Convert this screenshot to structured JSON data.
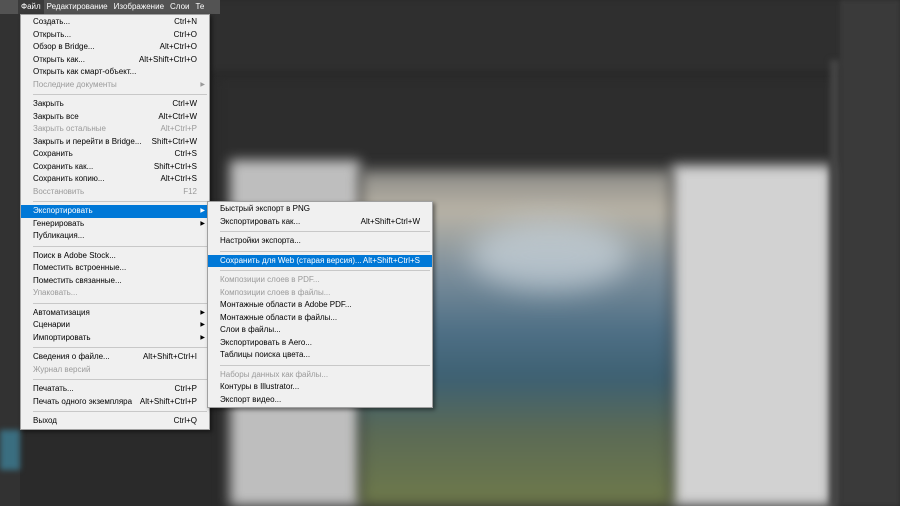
{
  "menubar": {
    "items": [
      "Файл",
      "Редактирование",
      "Изображение",
      "Слои",
      "Те"
    ]
  },
  "file_menu": {
    "items": [
      {
        "label": "Создать...",
        "shortcut": "Ctrl+N"
      },
      {
        "label": "Открыть...",
        "shortcut": "Ctrl+O"
      },
      {
        "label": "Обзор в Bridge...",
        "shortcut": "Alt+Ctrl+O"
      },
      {
        "label": "Открыть как...",
        "shortcut": "Alt+Shift+Ctrl+O"
      },
      {
        "label": "Открыть как смарт-объект...",
        "shortcut": ""
      },
      {
        "label": "Последние документы",
        "shortcut": "",
        "submenu": true,
        "disabled": true
      },
      {
        "sep": true
      },
      {
        "label": "Закрыть",
        "shortcut": "Ctrl+W"
      },
      {
        "label": "Закрыть все",
        "shortcut": "Alt+Ctrl+W"
      },
      {
        "label": "Закрыть остальные",
        "shortcut": "Alt+Ctrl+P",
        "disabled": true
      },
      {
        "label": "Закрыть и перейти в Bridge...",
        "shortcut": "Shift+Ctrl+W"
      },
      {
        "label": "Сохранить",
        "shortcut": "Ctrl+S"
      },
      {
        "label": "Сохранить как...",
        "shortcut": "Shift+Ctrl+S"
      },
      {
        "label": "Сохранить копию...",
        "shortcut": "Alt+Ctrl+S"
      },
      {
        "label": "Восстановить",
        "shortcut": "F12",
        "disabled": true
      },
      {
        "sep": true
      },
      {
        "label": "Экспортировать",
        "shortcut": "",
        "submenu": true,
        "highlighted": true
      },
      {
        "label": "Генерировать",
        "shortcut": "",
        "submenu": true
      },
      {
        "label": "Публикация...",
        "shortcut": ""
      },
      {
        "sep": true
      },
      {
        "label": "Поиск в Adobe Stock...",
        "shortcut": ""
      },
      {
        "label": "Поместить встроенные...",
        "shortcut": ""
      },
      {
        "label": "Поместить связанные...",
        "shortcut": ""
      },
      {
        "label": "Упаковать...",
        "shortcut": "",
        "disabled": true
      },
      {
        "sep": true
      },
      {
        "label": "Автоматизация",
        "shortcut": "",
        "submenu": true
      },
      {
        "label": "Сценарии",
        "shortcut": "",
        "submenu": true
      },
      {
        "label": "Импортировать",
        "shortcut": "",
        "submenu": true
      },
      {
        "sep": true
      },
      {
        "label": "Сведения о файле...",
        "shortcut": "Alt+Shift+Ctrl+I"
      },
      {
        "label": "Журнал версий",
        "shortcut": "",
        "disabled": true
      },
      {
        "sep": true
      },
      {
        "label": "Печатать...",
        "shortcut": "Ctrl+P"
      },
      {
        "label": "Печать одного экземпляра",
        "shortcut": "Alt+Shift+Ctrl+P"
      },
      {
        "sep": true
      },
      {
        "label": "Выход",
        "shortcut": "Ctrl+Q"
      }
    ]
  },
  "export_menu": {
    "items": [
      {
        "label": "Быстрый экспорт в PNG",
        "shortcut": ""
      },
      {
        "label": "Экспортировать как...",
        "shortcut": "Alt+Shift+Ctrl+W"
      },
      {
        "sep": true
      },
      {
        "label": "Настройки экспорта...",
        "shortcut": ""
      },
      {
        "sep": true
      },
      {
        "label": "Сохранить для Web (старая версия)...",
        "shortcut": "Alt+Shift+Ctrl+S",
        "highlighted": true
      },
      {
        "sep": true
      },
      {
        "label": "Композиции слоев в PDF...",
        "shortcut": "",
        "disabled": true
      },
      {
        "label": "Композиции слоев в файлы...",
        "shortcut": "",
        "disabled": true
      },
      {
        "label": "Монтажные области в Adobe PDF...",
        "shortcut": ""
      },
      {
        "label": "Монтажные области в файлы...",
        "shortcut": ""
      },
      {
        "label": "Слои в файлы...",
        "shortcut": ""
      },
      {
        "label": "Экспортировать в Aero...",
        "shortcut": ""
      },
      {
        "label": "Таблицы поиска цвета...",
        "shortcut": ""
      },
      {
        "sep": true
      },
      {
        "label": "Наборы данных как файлы...",
        "shortcut": "",
        "disabled": true
      },
      {
        "label": "Контуры в Illustrator...",
        "shortcut": ""
      },
      {
        "label": "Экспорт видео...",
        "shortcut": ""
      }
    ]
  },
  "colors": {
    "highlight": "#0078d7",
    "menu_bg": "#f0f0f0",
    "disabled_text": "#9a9a9a"
  }
}
